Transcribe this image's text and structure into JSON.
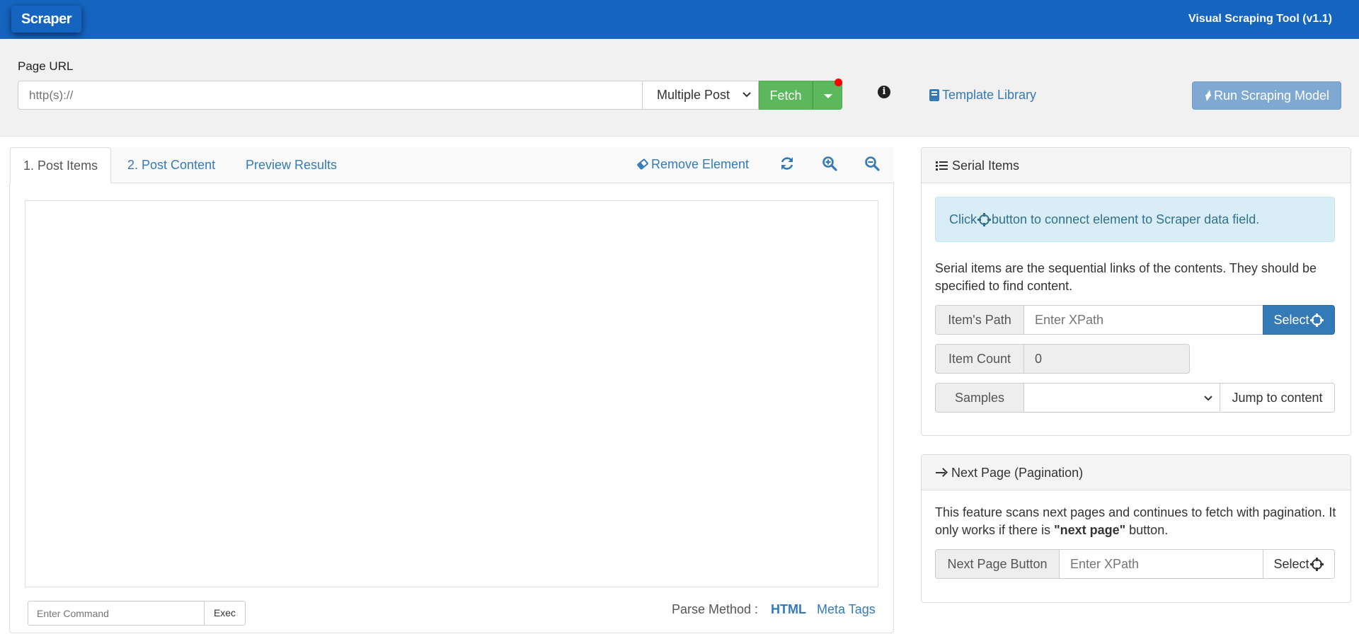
{
  "header": {
    "logo": "Scraper",
    "app_title": "Visual Scraping Tool (v1.1)"
  },
  "urlbar": {
    "label": "Page URL",
    "url_placeholder": "http(s)://",
    "mode_selected": "Multiple Post",
    "fetch_label": "Fetch",
    "template_library": "Template Library",
    "run_label": "Run Scraping Model"
  },
  "left": {
    "tabs": [
      {
        "num": "1.",
        "label": "Post Items"
      },
      {
        "num": "2.",
        "label": "Post Content"
      },
      {
        "num": "",
        "label": "Preview Results"
      }
    ],
    "remove_element": "Remove Element",
    "command_placeholder": "Enter Command",
    "exec_label": "Exec",
    "parse_label": "Parse Method :",
    "parse_html": "HTML",
    "parse_meta": "Meta Tags"
  },
  "serial": {
    "title": "Serial Items",
    "info_pre": "Click",
    "info_post": "button to connect element to Scraper data field.",
    "description": "Serial items are the sequential links of the contents. They should be specified to find content.",
    "path_label": "Item's Path",
    "path_placeholder": "Enter XPath",
    "select_label": "Select",
    "count_label": "Item Count",
    "count_value": "0",
    "samples_label": "Samples",
    "jump_label": "Jump to content"
  },
  "pagination": {
    "title": "Next Page (Pagination)",
    "desc_pre": "This feature scans next pages and continues to fetch with pagination. It only works if there is ",
    "desc_bold": "\"next page\"",
    "desc_post": " button.",
    "button_label": "Next Page Button",
    "placeholder": "Enter XPath",
    "select_label": "Select"
  },
  "colors": {
    "header": "#1565c0",
    "fetch": "#5cb85c",
    "primary": "#337ab7",
    "info_bg": "#d9edf7",
    "notification_dot": "#ff0000"
  },
  "icons": [
    "info-icon",
    "book-icon",
    "bolt-icon",
    "eraser-icon",
    "refresh-icon",
    "zoom-in-icon",
    "zoom-out-icon",
    "list-icon",
    "crosshair-icon",
    "arrow-right-icon",
    "chevron-down-icon"
  ]
}
